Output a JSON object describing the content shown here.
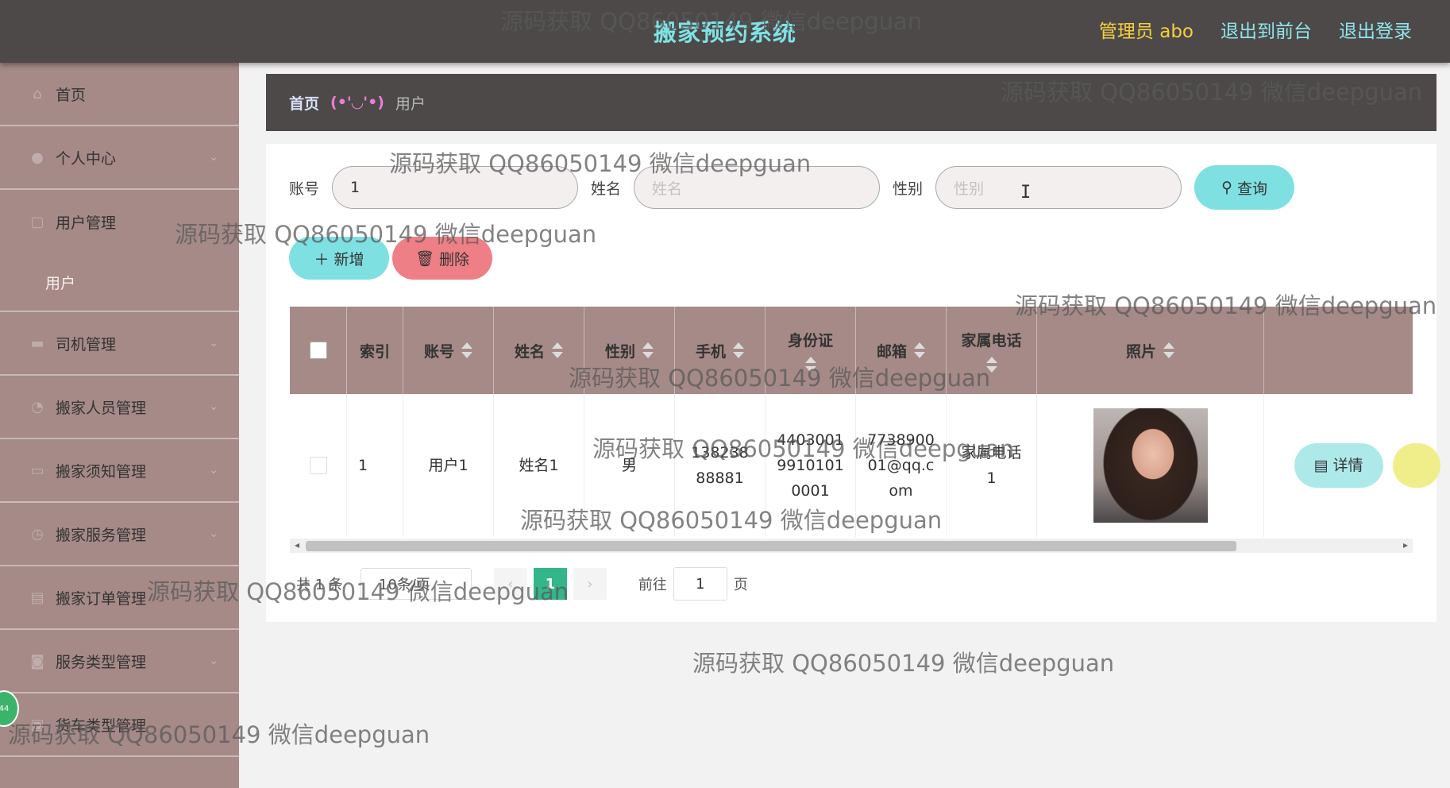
{
  "header": {
    "app_title": "搬家预约系统",
    "admin_label": "管理员 abo",
    "to_front_label": "退出到前台",
    "logout_label": "退出登录"
  },
  "sidebar": {
    "items": [
      {
        "label": "首页",
        "icon": "home-icon"
      },
      {
        "label": "个人中心",
        "icon": "user-icon"
      },
      {
        "label": "用户管理",
        "icon": "users-icon"
      },
      {
        "label": "司机管理",
        "icon": "truck-icon"
      },
      {
        "label": "搬家人员管理",
        "icon": "worker-icon"
      },
      {
        "label": "搬家须知管理",
        "icon": "notice-icon"
      },
      {
        "label": "搬家服务管理",
        "icon": "service-icon"
      },
      {
        "label": "搬家订单管理",
        "icon": "order-icon"
      },
      {
        "label": "服务类型管理",
        "icon": "type-icon"
      },
      {
        "label": "货车类型管理",
        "icon": "vehicle-icon"
      }
    ],
    "sub_item": "用户"
  },
  "breadcrumb": {
    "home": "首页",
    "separator": "(•'◡'•)",
    "current": "用户"
  },
  "filters": {
    "account_label": "账号",
    "account_value": "1",
    "name_label": "姓名",
    "name_placeholder": "姓名",
    "gender_label": "性别",
    "gender_placeholder": "性别",
    "query_label": "查询"
  },
  "actions": {
    "add_label": "新增",
    "delete_label": "删除"
  },
  "table": {
    "headers": [
      "索引",
      "账号",
      "姓名",
      "性别",
      "手机",
      "身份证",
      "邮箱",
      "家属电话",
      "照片"
    ],
    "rows": [
      {
        "index": "1",
        "account": "用户1",
        "name": "姓名1",
        "gender": "男",
        "phone": "13823888881",
        "id_card": "440300199101010001",
        "email": "773890001@qq.com",
        "family_phone": "家属电话1",
        "detail_label": "详情"
      }
    ]
  },
  "pagination": {
    "total_text": "共 1 条",
    "page_size": "10条/页",
    "current_page": "1",
    "goto_label": "前往",
    "goto_value": "1",
    "page_suffix": "页"
  },
  "watermark_text": "源码获取 QQ86050149 微信deepguan",
  "colors": {
    "topbar": "#4d4949",
    "sidebar": "#a58a87",
    "accent_cyan": "#7fe0e2",
    "delete_red": "#ee7f86",
    "pager_active": "#33b68a",
    "title": "#7fe3e6"
  }
}
